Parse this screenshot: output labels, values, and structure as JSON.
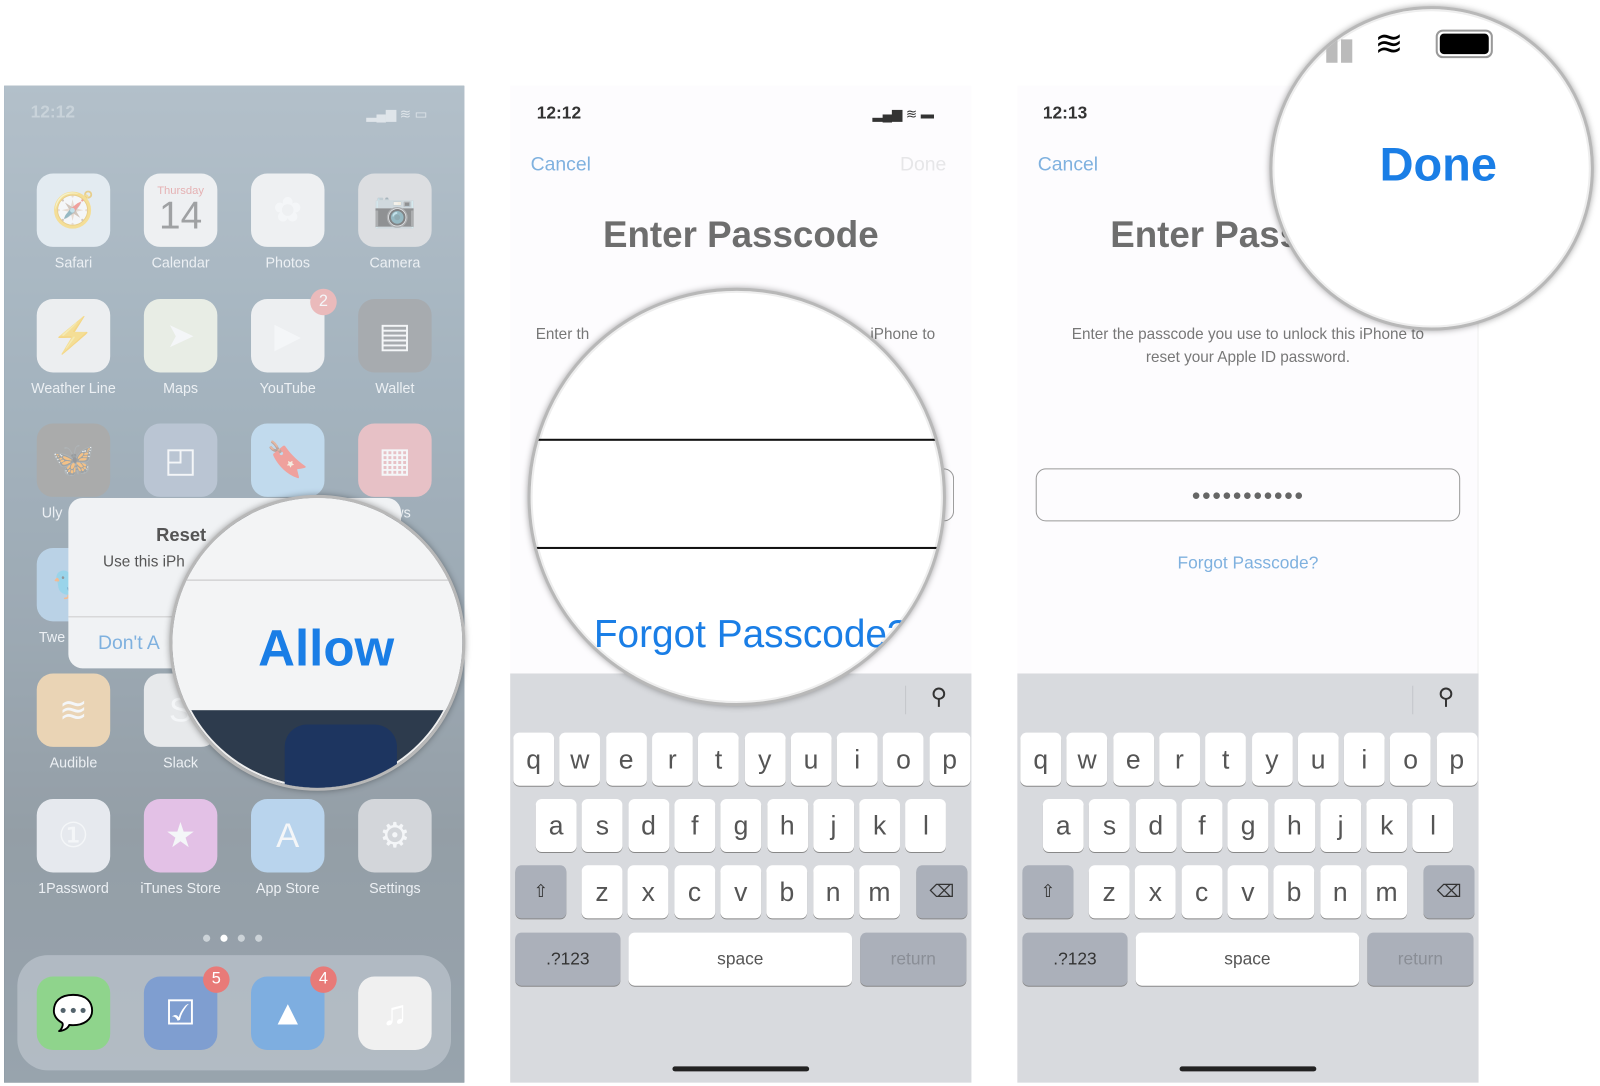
{
  "panel1": {
    "status_time": "12:12",
    "apps": [
      {
        "label": "Safari",
        "icon": "safari-icon",
        "color": "#d9e6f0",
        "glyph": "🧭"
      },
      {
        "label": "Calendar",
        "icon": "calendar-icon",
        "color": "#f2f2f2",
        "day": "Thursday",
        "date": "14"
      },
      {
        "label": "Photos",
        "icon": "photos-icon",
        "color": "#f2f2f2",
        "glyph": "✿"
      },
      {
        "label": "Camera",
        "icon": "camera-icon",
        "color": "#c9cacc",
        "glyph": "📷"
      },
      {
        "label": "Weather Line",
        "icon": "weather-line-icon",
        "color": "#eeeeee",
        "glyph": "⚡"
      },
      {
        "label": "Maps",
        "icon": "maps-icon",
        "color": "#e4ead4",
        "glyph": "➤"
      },
      {
        "label": "YouTube",
        "icon": "youtube-icon",
        "color": "#f0f0f0",
        "glyph": "▶",
        "badge": "2"
      },
      {
        "label": "Wallet",
        "icon": "wallet-icon",
        "color": "#55595e",
        "glyph": "▤"
      },
      {
        "label": "Uly",
        "icon": "ulysses-icon",
        "color": "#5b5a55",
        "glyph": "🦋"
      },
      {
        "label": "",
        "icon": "app-icon",
        "color": "#7e93ad",
        "glyph": "◰"
      },
      {
        "label": "",
        "icon": "bookmark-icon",
        "color": "#8ec2e6",
        "glyph": "🔖"
      },
      {
        "label": "ws",
        "icon": "news-icon",
        "color": "#e38a90",
        "glyph": "▦"
      },
      {
        "label": "Twe",
        "icon": "tweetbot-icon",
        "color": "#7fb0d8",
        "glyph": "🐦"
      },
      {
        "label": "Audible",
        "icon": "audible-icon",
        "color": "#e8b36a",
        "glyph": "≋"
      },
      {
        "label": "Slack",
        "icon": "slack-icon",
        "color": "#e3e3e3",
        "glyph": "S"
      },
      {
        "label": "1Password",
        "icon": "1password-icon",
        "color": "#dfe3e8",
        "glyph": "①"
      },
      {
        "label": "iTunes Store",
        "icon": "itunes-store-icon",
        "color": "#d98ad8",
        "glyph": "★"
      },
      {
        "label": "App Store",
        "icon": "app-store-icon",
        "color": "#7cb4e6",
        "glyph": "A"
      },
      {
        "label": "Settings",
        "icon": "settings-icon",
        "color": "#b5b8bc",
        "glyph": "⚙"
      }
    ],
    "dock": [
      {
        "icon": "messages-icon",
        "color": "#8fd48c",
        "glyph": "💬"
      },
      {
        "icon": "tasks-icon",
        "color": "#7f9ed0",
        "glyph": "☑",
        "badge": "5"
      },
      {
        "icon": "spark-mail-icon",
        "color": "#7eaee0",
        "glyph": "▲",
        "badge": "4"
      },
      {
        "icon": "music-icon",
        "color": "#f0f0f0",
        "glyph": "♫"
      }
    ],
    "dialog": {
      "title": "Reset",
      "message": "Use this iPh",
      "dont_allow": "Don't A"
    },
    "magnifier": {
      "allow": "Allow"
    }
  },
  "panel2": {
    "status_time": "12:12",
    "cancel": "Cancel",
    "done": "Done",
    "title": "Enter Passcode",
    "desc_left": "Enter th",
    "desc_right": "iPhone to",
    "magnifier": {
      "forgot": "Forgot Passcode?"
    }
  },
  "panel3": {
    "status_time": "12:13",
    "cancel": "Cancel",
    "title": "Enter Pass",
    "desc_line1": "Enter the passcode you use to unlock this iPhone to",
    "desc_line2": "reset your Apple ID password.",
    "passcode_masked": "●●●●●●●●●●●",
    "forgot": "Forgot Passcode?",
    "magnifier": {
      "done": "Done"
    }
  },
  "keyboard": {
    "row1": [
      "q",
      "w",
      "e",
      "r",
      "t",
      "y",
      "u",
      "i",
      "o",
      "p"
    ],
    "row2": [
      "a",
      "s",
      "d",
      "f",
      "g",
      "h",
      "j",
      "k",
      "l"
    ],
    "row3": [
      "z",
      "x",
      "c",
      "v",
      "b",
      "n",
      "m"
    ],
    "numbers": ".?123",
    "space": "space",
    "return": "return"
  },
  "colors": {
    "accent": "#1a7ee6",
    "accent_faded": "#7fb1df",
    "title_gray": "#6e6e6e"
  }
}
